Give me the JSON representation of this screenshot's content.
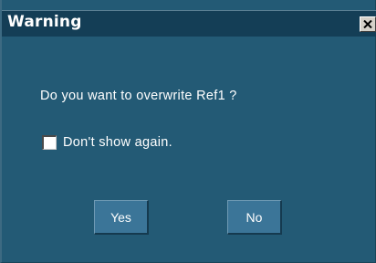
{
  "dialog": {
    "title": "Warning",
    "close_icon": "close-icon",
    "message": "Do you want to overwrite Ref1 ?",
    "checkbox": {
      "label": "Don't show again.",
      "checked": false
    },
    "buttons": {
      "yes_label": "Yes",
      "no_label": "No"
    }
  },
  "colors": {
    "dialog_background": "#235a75",
    "title_bar": "#143e56",
    "button_face": "#3b7598",
    "text": "#ffffff"
  }
}
